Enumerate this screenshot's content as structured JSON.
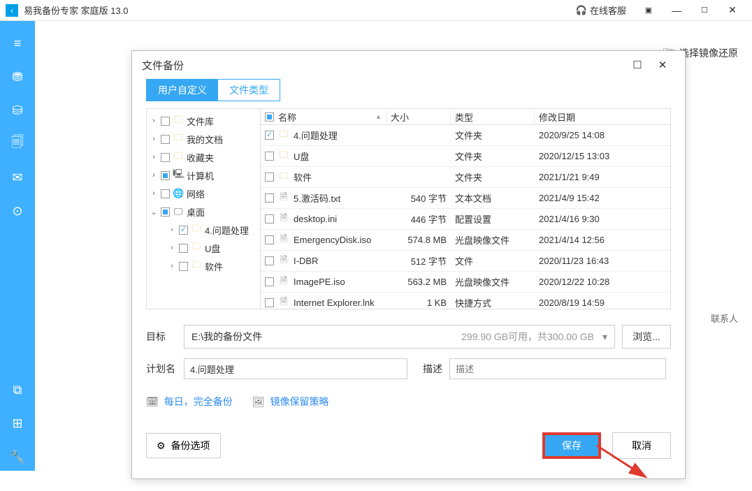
{
  "titlebar": {
    "title": "易我备份专家 家庭版 13.0",
    "online": "在线客服"
  },
  "topright": {
    "label": "选择镜像还原"
  },
  "contact": "联系人",
  "dialog": {
    "title": "文件备份",
    "tabs": {
      "custom": "用户自定义",
      "filetype": "文件类型"
    },
    "tree": [
      {
        "depth": 1,
        "exp": "›",
        "cb": "",
        "icon": "folder",
        "label": "文件库"
      },
      {
        "depth": 1,
        "exp": "›",
        "cb": "",
        "icon": "folder",
        "label": "我的文档"
      },
      {
        "depth": 1,
        "exp": "›",
        "cb": "",
        "icon": "folder",
        "label": "收藏夹"
      },
      {
        "depth": 1,
        "exp": "›",
        "cb": "partial",
        "icon": "computer",
        "label": "计算机"
      },
      {
        "depth": 1,
        "exp": "›",
        "cb": "",
        "icon": "network",
        "label": "网络"
      },
      {
        "depth": 1,
        "exp": "⌄",
        "cb": "partial",
        "icon": "desktop",
        "label": "桌面"
      },
      {
        "depth": 2,
        "exp": "›",
        "cb": "checked",
        "icon": "folder",
        "label": "4.问题处理"
      },
      {
        "depth": 2,
        "exp": "›",
        "cb": "",
        "icon": "folder",
        "label": "U盘"
      },
      {
        "depth": 2,
        "exp": "›",
        "cb": "",
        "icon": "folder",
        "label": "软件"
      }
    ],
    "columns": {
      "name": "名称",
      "size": "大小",
      "type": "类型",
      "date": "修改日期"
    },
    "files": [
      {
        "cb": "checked",
        "icon": "fold",
        "name": "4.问题处理",
        "size": "",
        "type": "文件夹",
        "date": "2020/9/25 14:08"
      },
      {
        "cb": "",
        "icon": "fold",
        "name": "U盘",
        "size": "",
        "type": "文件夹",
        "date": "2020/12/15 13:03"
      },
      {
        "cb": "",
        "icon": "fold",
        "name": "软件",
        "size": "",
        "type": "文件夹",
        "date": "2021/1/21 9:49"
      },
      {
        "cb": "",
        "icon": "file",
        "name": "5.激活码.txt",
        "size": "540 字节",
        "type": "文本文档",
        "date": "2021/4/9 15:42"
      },
      {
        "cb": "",
        "icon": "file",
        "name": "desktop.ini",
        "size": "446 字节",
        "type": "配置设置",
        "date": "2021/4/16 9:30"
      },
      {
        "cb": "",
        "icon": "file",
        "name": "EmergencyDisk.iso",
        "size": "574.8 MB",
        "type": "光盘映像文件",
        "date": "2021/4/14 12:56"
      },
      {
        "cb": "",
        "icon": "file",
        "name": "I-DBR",
        "size": "512 字节",
        "type": "文件",
        "date": "2020/11/23 16:43"
      },
      {
        "cb": "",
        "icon": "file",
        "name": "ImagePE.iso",
        "size": "563.2 MB",
        "type": "光盘映像文件",
        "date": "2020/12/22 10:28"
      },
      {
        "cb": "",
        "icon": "file",
        "name": "Internet Explorer.lnk",
        "size": "1 KB",
        "type": "快捷方式",
        "date": "2020/8/19 14:59"
      }
    ],
    "target_label": "目标",
    "target_path": "E:\\我的备份文件",
    "target_avail": "299.90 GB可用，共300.00 GB",
    "browse": "浏览...",
    "plan_label": "计划名",
    "plan_value": "4.问题处理",
    "desc_label": "描述",
    "desc_placeholder": "描述",
    "schedule": "每日，完全备份",
    "retention": "镜像保留策略",
    "backup_options": "备份选项",
    "save": "保存",
    "cancel": "取消"
  }
}
